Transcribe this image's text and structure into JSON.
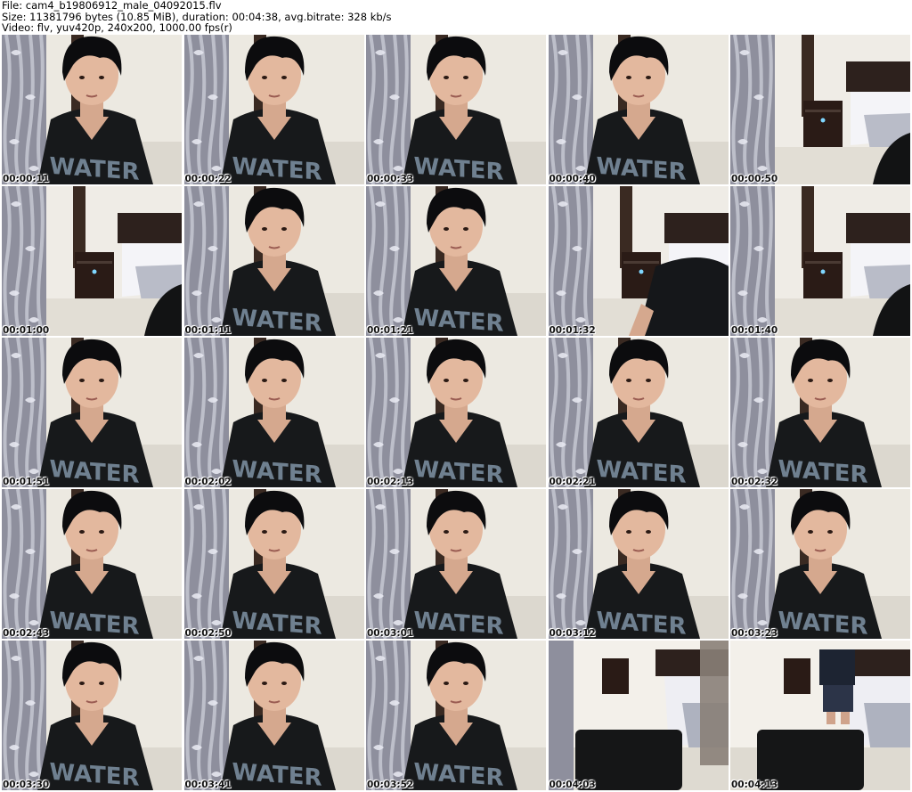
{
  "header": {
    "line1": "File: cam4_b19806912_male_04092015.flv",
    "line2": "Size: 11381796 bytes (10.85 MiB), duration: 00:04:38, avg.bitrate: 328 kb/s",
    "line3": "Video: flv, yuv420p, 240x200, 1000.00 fps(r)"
  },
  "shirt_text": "WATER",
  "frames": [
    {
      "timestamp": "00:00:11",
      "scene": "person"
    },
    {
      "timestamp": "00:00:22",
      "scene": "person"
    },
    {
      "timestamp": "00:00:33",
      "scene": "person"
    },
    {
      "timestamp": "00:00:40",
      "scene": "person"
    },
    {
      "timestamp": "00:00:50",
      "scene": "room"
    },
    {
      "timestamp": "00:01:00",
      "scene": "room"
    },
    {
      "timestamp": "00:01:11",
      "scene": "person"
    },
    {
      "timestamp": "00:01:21",
      "scene": "person"
    },
    {
      "timestamp": "00:01:32",
      "scene": "room-partial"
    },
    {
      "timestamp": "00:01:40",
      "scene": "room"
    },
    {
      "timestamp": "00:01:51",
      "scene": "person"
    },
    {
      "timestamp": "00:02:02",
      "scene": "person"
    },
    {
      "timestamp": "00:02:13",
      "scene": "person"
    },
    {
      "timestamp": "00:02:21",
      "scene": "person"
    },
    {
      "timestamp": "00:02:32",
      "scene": "person"
    },
    {
      "timestamp": "00:02:43",
      "scene": "person"
    },
    {
      "timestamp": "00:02:50",
      "scene": "person"
    },
    {
      "timestamp": "00:03:01",
      "scene": "person"
    },
    {
      "timestamp": "00:03:12",
      "scene": "person"
    },
    {
      "timestamp": "00:03:23",
      "scene": "person"
    },
    {
      "timestamp": "00:03:30",
      "scene": "person"
    },
    {
      "timestamp": "00:03:41",
      "scene": "person"
    },
    {
      "timestamp": "00:03:52",
      "scene": "person"
    },
    {
      "timestamp": "00:04:03",
      "scene": "chair"
    },
    {
      "timestamp": "00:04:13",
      "scene": "chair-standing"
    }
  ]
}
